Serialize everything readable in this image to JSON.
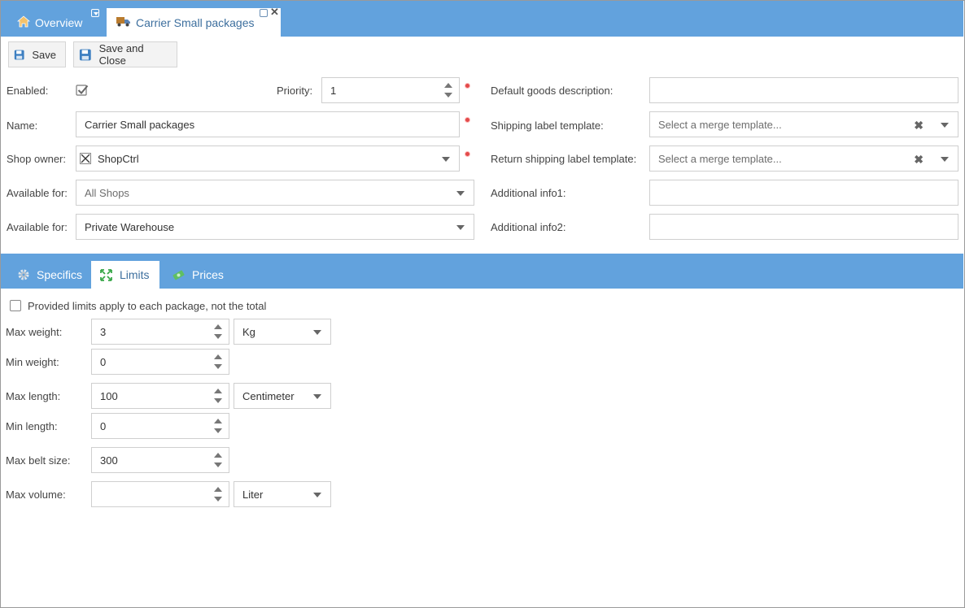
{
  "tabs": {
    "overview": "Overview",
    "carrier": "Carrier Small packages"
  },
  "toolbar": {
    "save_label": "Save",
    "save_close_label": "Save and Close"
  },
  "form": {
    "enabled_label": "Enabled:",
    "priority_label": "Priority:",
    "priority_value": "1",
    "name_label": "Name:",
    "name_value": "Carrier Small packages",
    "shop_owner_label": "Shop owner:",
    "shop_owner_value": "ShopCtrl",
    "available_for_label_1": "Available for:",
    "available_for_value_1": "All Shops",
    "available_for_label_2": "Available for:",
    "available_for_value_2": "Private Warehouse",
    "default_goods_label": "Default goods description:",
    "default_goods_value": "",
    "shipping_label_label": "Shipping label template:",
    "shipping_label_placeholder": "Select a merge template...",
    "return_label_label": "Return shipping label template:",
    "return_label_placeholder": "Select a merge template...",
    "info1_label": "Additional info1:",
    "info1_value": "",
    "info2_label": "Additional info2:",
    "info2_value": ""
  },
  "subtabs": {
    "specifics": "Specifics",
    "limits": "Limits",
    "prices": "Prices"
  },
  "limits": {
    "apply_each_label": "Provided limits apply to each package, not the total",
    "max_weight_label": "Max weight:",
    "max_weight_value": "3",
    "weight_unit": "Kg",
    "min_weight_label": "Min weight:",
    "min_weight_value": "0",
    "max_length_label": "Max length:",
    "max_length_value": "100",
    "length_unit": "Centimeter",
    "min_length_label": "Min length:",
    "min_length_value": "0",
    "max_belt_label": "Max belt size:",
    "max_belt_value": "300",
    "max_volume_label": "Max volume:",
    "max_volume_value": "",
    "volume_unit": "Liter"
  }
}
